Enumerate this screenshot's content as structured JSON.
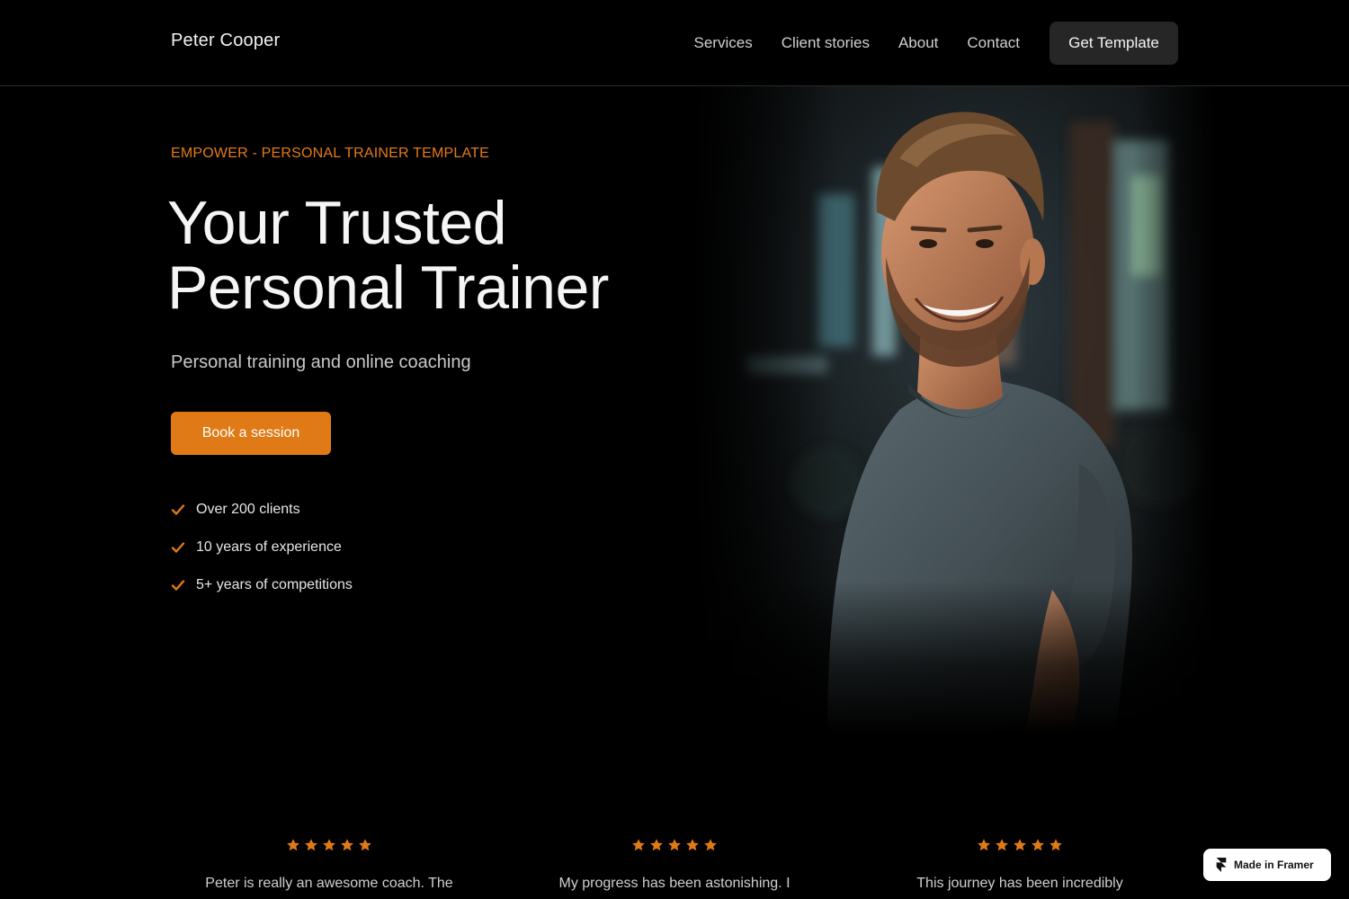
{
  "nav": {
    "brand": "Peter Cooper",
    "links": [
      "Services",
      "Client stories",
      "About",
      "Contact"
    ],
    "cta": "Get Template"
  },
  "hero": {
    "eyebrow": "EMPOWER - PERSONAL TRAINER TEMPLATE",
    "title_line1": "Your Trusted",
    "title_line2": "Personal Trainer",
    "subtitle": "Personal training and online coaching",
    "button": "Book a session",
    "checklist": [
      "Over 200 clients",
      "10 years of experience",
      "5+ years of competitions"
    ]
  },
  "testimonials": [
    {
      "rating": 5,
      "quote": "Peter is really an awesome coach. The"
    },
    {
      "rating": 5,
      "quote": "My progress has been astonishing. I"
    },
    {
      "rating": 5,
      "quote": "This journey has been incredibly"
    }
  ],
  "badge": {
    "label": "Made in Framer"
  },
  "colors": {
    "accent": "#E07A16",
    "background": "#000000",
    "nav_button": "#262626"
  }
}
